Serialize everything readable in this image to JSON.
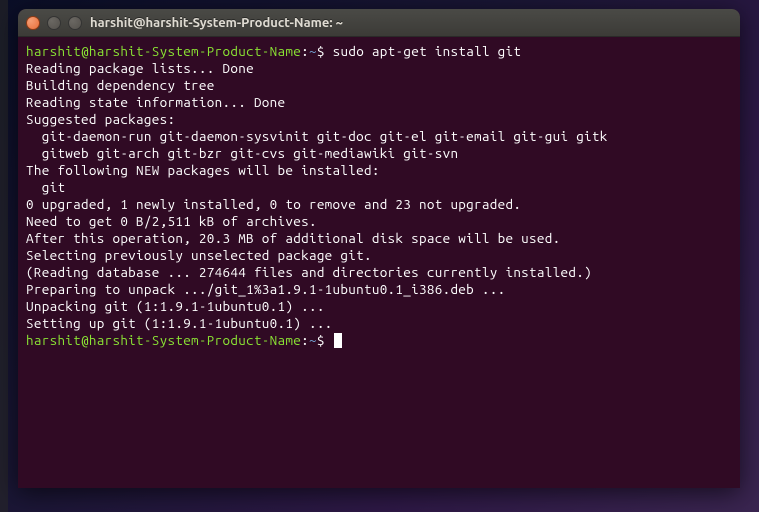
{
  "window": {
    "title": "harshit@harshit-System-Product-Name: ~"
  },
  "prompt": {
    "user_host": "harshit@harshit-System-Product-Name",
    "separator": ":",
    "path": "~",
    "symbol": "$"
  },
  "command": "sudo apt-get install git",
  "output": {
    "l1": "Reading package lists... Done",
    "l2": "Building dependency tree",
    "l3": "Reading state information... Done",
    "l4": "Suggested packages:",
    "l5": "  git-daemon-run git-daemon-sysvinit git-doc git-el git-email git-gui gitk",
    "l6": "  gitweb git-arch git-bzr git-cvs git-mediawiki git-svn",
    "l7": "The following NEW packages will be installed:",
    "l8": "  git",
    "l9": "0 upgraded, 1 newly installed, 0 to remove and 23 not upgraded.",
    "l10": "Need to get 0 B/2,511 kB of archives.",
    "l11": "After this operation, 20.3 MB of additional disk space will be used.",
    "l12": "Selecting previously unselected package git.",
    "l13": "(Reading database ... 274644 files and directories currently installed.)",
    "l14": "Preparing to unpack .../git_1%3a1.9.1-1ubuntu0.1_i386.deb ...",
    "l15": "Unpacking git (1:1.9.1-1ubuntu0.1) ...",
    "l16": "Setting up git (1:1.9.1-1ubuntu0.1) ..."
  }
}
